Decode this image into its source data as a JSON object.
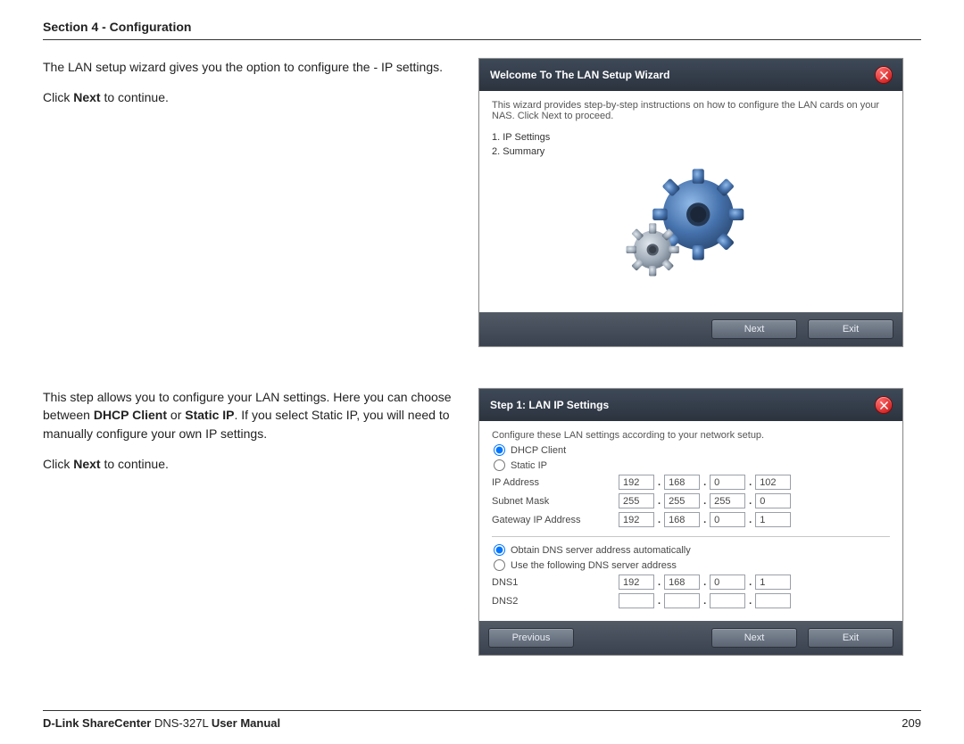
{
  "header": {
    "section": "Section 4 - Configuration"
  },
  "footer": {
    "brand_bold": "D-Link ShareCenter",
    "brand_rest": " DNS-327L ",
    "brand_tail": "User Manual",
    "page_no": "209"
  },
  "block1": {
    "p1": "The LAN setup wizard gives you the option to configure the - IP settings.",
    "p2a": "Click ",
    "p2b": "Next",
    "p2c": " to continue."
  },
  "block2": {
    "p1a": "This step allows you to configure your LAN settings. Here you can choose between ",
    "p1b": "DHCP Client",
    "p1c": " or ",
    "p1d": "Static IP",
    "p1e": ". If you select Static IP, you will need to manually configure your own IP settings.",
    "p2a": "Click ",
    "p2b": "Next",
    "p2c": " to continue."
  },
  "wizard1": {
    "title": "Welcome To The LAN Setup Wizard",
    "intro": "This wizard provides step-by-step instructions on how to configure the LAN cards on your NAS. Click Next to proceed.",
    "step1": "1. IP Settings",
    "step2": "2. Summary",
    "btn_next": "Next",
    "btn_exit": "Exit"
  },
  "wizard2": {
    "title": "Step 1: LAN IP Settings",
    "intro": "Configure these LAN settings according to your network setup.",
    "radio_dhcp": "DHCP Client",
    "radio_static": "Static IP",
    "lbl_ip": "IP Address",
    "lbl_mask": "Subnet Mask",
    "lbl_gw": "Gateway IP Address",
    "ip": [
      "192",
      "168",
      "0",
      "102"
    ],
    "mask": [
      "255",
      "255",
      "255",
      "0"
    ],
    "gw": [
      "192",
      "168",
      "0",
      "1"
    ],
    "radio_dns_auto": "Obtain DNS server address automatically",
    "radio_dns_manual": "Use the following DNS server address",
    "lbl_dns1": "DNS1",
    "lbl_dns2": "DNS2",
    "dns1": [
      "192",
      "168",
      "0",
      "1"
    ],
    "dns2": [
      "",
      "",
      "",
      ""
    ],
    "btn_prev": "Previous",
    "btn_next": "Next",
    "btn_exit": "Exit"
  }
}
